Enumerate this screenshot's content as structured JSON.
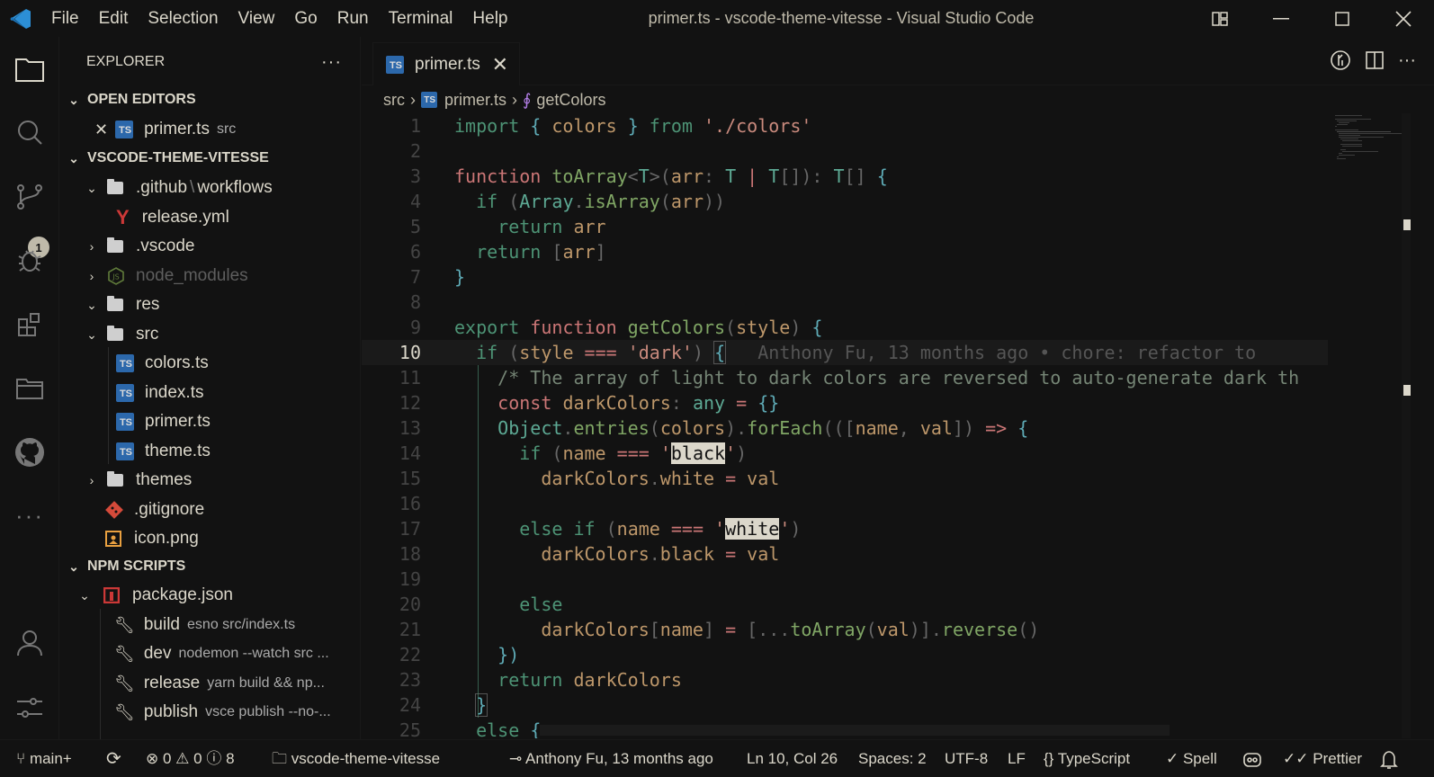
{
  "window": {
    "title": "primer.ts - vscode-theme-vitesse - Visual Studio Code",
    "menu": [
      "File",
      "Edit",
      "Selection",
      "View",
      "Go",
      "Run",
      "Terminal",
      "Help"
    ]
  },
  "activity": {
    "source_control_badge": "1",
    "icons": [
      "files-icon",
      "search-icon",
      "source-control-icon",
      "debug-icon",
      "extensions-icon",
      "folders-icon",
      "github-icon",
      "more-icon",
      "account-icon",
      "settings-icon"
    ]
  },
  "sidebar": {
    "title": "EXPLORER",
    "more": "···",
    "open_editors": {
      "label": "OPEN EDITORS",
      "items": [
        {
          "name": "primer.ts",
          "path": "src"
        }
      ]
    },
    "project": {
      "label": "VSCODE-THEME-VITESSE",
      "items": [
        {
          "name": ".github",
          "suffix": "workflows",
          "sep": "\\"
        },
        {
          "name": "release.yml"
        },
        {
          "name": ".vscode"
        },
        {
          "name": "node_modules"
        },
        {
          "name": "res"
        },
        {
          "name": "src"
        },
        {
          "name": "colors.ts"
        },
        {
          "name": "index.ts"
        },
        {
          "name": "primer.ts"
        },
        {
          "name": "theme.ts"
        },
        {
          "name": "themes"
        },
        {
          "name": ".gitignore"
        },
        {
          "name": "icon.png"
        }
      ]
    },
    "npm": {
      "label": "NPM SCRIPTS",
      "package": "package.json",
      "scripts": [
        {
          "name": "build",
          "cmd": "esno src/index.ts"
        },
        {
          "name": "dev",
          "cmd": "nodemon --watch src ..."
        },
        {
          "name": "release",
          "cmd": "yarn build && np..."
        },
        {
          "name": "publish",
          "cmd": "vsce publish --no-..."
        }
      ]
    }
  },
  "editor": {
    "tab_label": "primer.ts",
    "tab_icon": "TS",
    "breadcrumb": [
      "src",
      "primer.ts",
      "getColors"
    ],
    "current_line": 10,
    "blame": "Anthony Fu, 13 months ago • chore: refactor to",
    "line_numbers": [
      "1",
      "2",
      "3",
      "4",
      "5",
      "6",
      "7",
      "8",
      "9",
      "10",
      "11",
      "12",
      "13",
      "14",
      "15",
      "16",
      "17",
      "18",
      "19",
      "20",
      "21",
      "22",
      "23",
      "24",
      "25"
    ]
  },
  "status": {
    "branch": "main+",
    "sync": "⟳",
    "errors": "0",
    "warnings": "0",
    "info": "8",
    "folder": "vscode-theme-vitesse",
    "blame": "Anthony Fu, 13 months ago",
    "position": "Ln 10, Col 26",
    "spaces": "Spaces: 2",
    "encoding": "UTF-8",
    "eol": "LF",
    "language": "TypeScript",
    "spell": "Spell",
    "prettier": "Prettier"
  },
  "colors": {
    "background": "#121212",
    "foreground": "#dbd7ca",
    "keyword": "#4d9375",
    "function": "#80a665",
    "string": "#c98a7d",
    "variable": "#bd976a",
    "operator": "#cb7676",
    "comment": "#758575",
    "ts_blue": "#3178c6"
  }
}
